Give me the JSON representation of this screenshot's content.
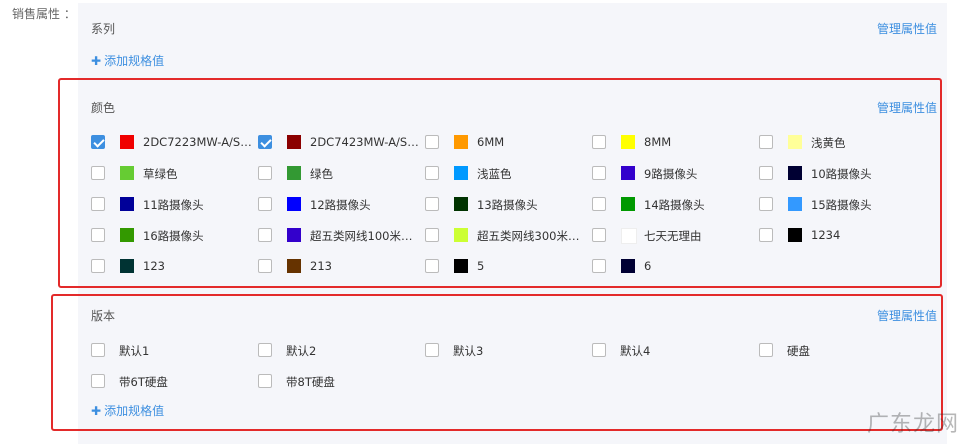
{
  "sales_attr_label": "销售属性 ：",
  "series": {
    "title": "系列",
    "manage_label": "管理属性值",
    "add_label": "添加规格值"
  },
  "color": {
    "title": "颜色",
    "manage_label": "管理属性值",
    "options": [
      {
        "label": "2DC7223MW-A/S…",
        "color": "#f00000",
        "checked": true
      },
      {
        "label": "2DC7423MW-A/S…",
        "color": "#8b0000",
        "checked": true
      },
      {
        "label": "6MM",
        "color": "#ff9900",
        "checked": false
      },
      {
        "label": "8MM",
        "color": "#ffff00",
        "checked": false
      },
      {
        "label": "浅黄色",
        "color": "#ffff99",
        "checked": false
      },
      {
        "label": "草绿色",
        "color": "#66cc33",
        "checked": false
      },
      {
        "label": "绿色",
        "color": "#339933",
        "checked": false
      },
      {
        "label": "浅蓝色",
        "color": "#0099ff",
        "checked": false
      },
      {
        "label": "9路摄像头",
        "color": "#3300cc",
        "checked": false
      },
      {
        "label": "10路摄像头",
        "color": "#000033",
        "checked": false
      },
      {
        "label": "11路摄像头",
        "color": "#000099",
        "checked": false
      },
      {
        "label": "12路摄像头",
        "color": "#0000ff",
        "checked": false
      },
      {
        "label": "13路摄像头",
        "color": "#003300",
        "checked": false
      },
      {
        "label": "14路摄像头",
        "color": "#009900",
        "checked": false
      },
      {
        "label": "15路摄像头",
        "color": "#3399ff",
        "checked": false
      },
      {
        "label": "16路摄像头",
        "color": "#339900",
        "checked": false
      },
      {
        "label": "超五类网线100米…",
        "color": "#3300cc",
        "checked": false
      },
      {
        "label": "超五类网线300米…",
        "color": "#ccff33",
        "checked": false
      },
      {
        "label": "七天无理由",
        "color": "#ffffff",
        "checked": false
      },
      {
        "label": "1234",
        "color": "#000000",
        "checked": false
      },
      {
        "label": "123",
        "color": "#003333",
        "checked": false
      },
      {
        "label": "213",
        "color": "#663300",
        "checked": false
      },
      {
        "label": "5",
        "color": "#000000",
        "checked": false
      },
      {
        "label": "6",
        "color": "#000033",
        "checked": false
      }
    ]
  },
  "version": {
    "title": "版本",
    "manage_label": "管理属性值",
    "add_label": "添加规格值",
    "options": [
      {
        "label": "默认1",
        "checked": false
      },
      {
        "label": "默认2",
        "checked": false
      },
      {
        "label": "默认3",
        "checked": false
      },
      {
        "label": "默认4",
        "checked": false
      },
      {
        "label": "硬盘",
        "checked": false
      },
      {
        "label": "带6T硬盘",
        "checked": false
      },
      {
        "label": "带8T硬盘",
        "checked": false
      }
    ]
  },
  "watermark": "广东龙网"
}
